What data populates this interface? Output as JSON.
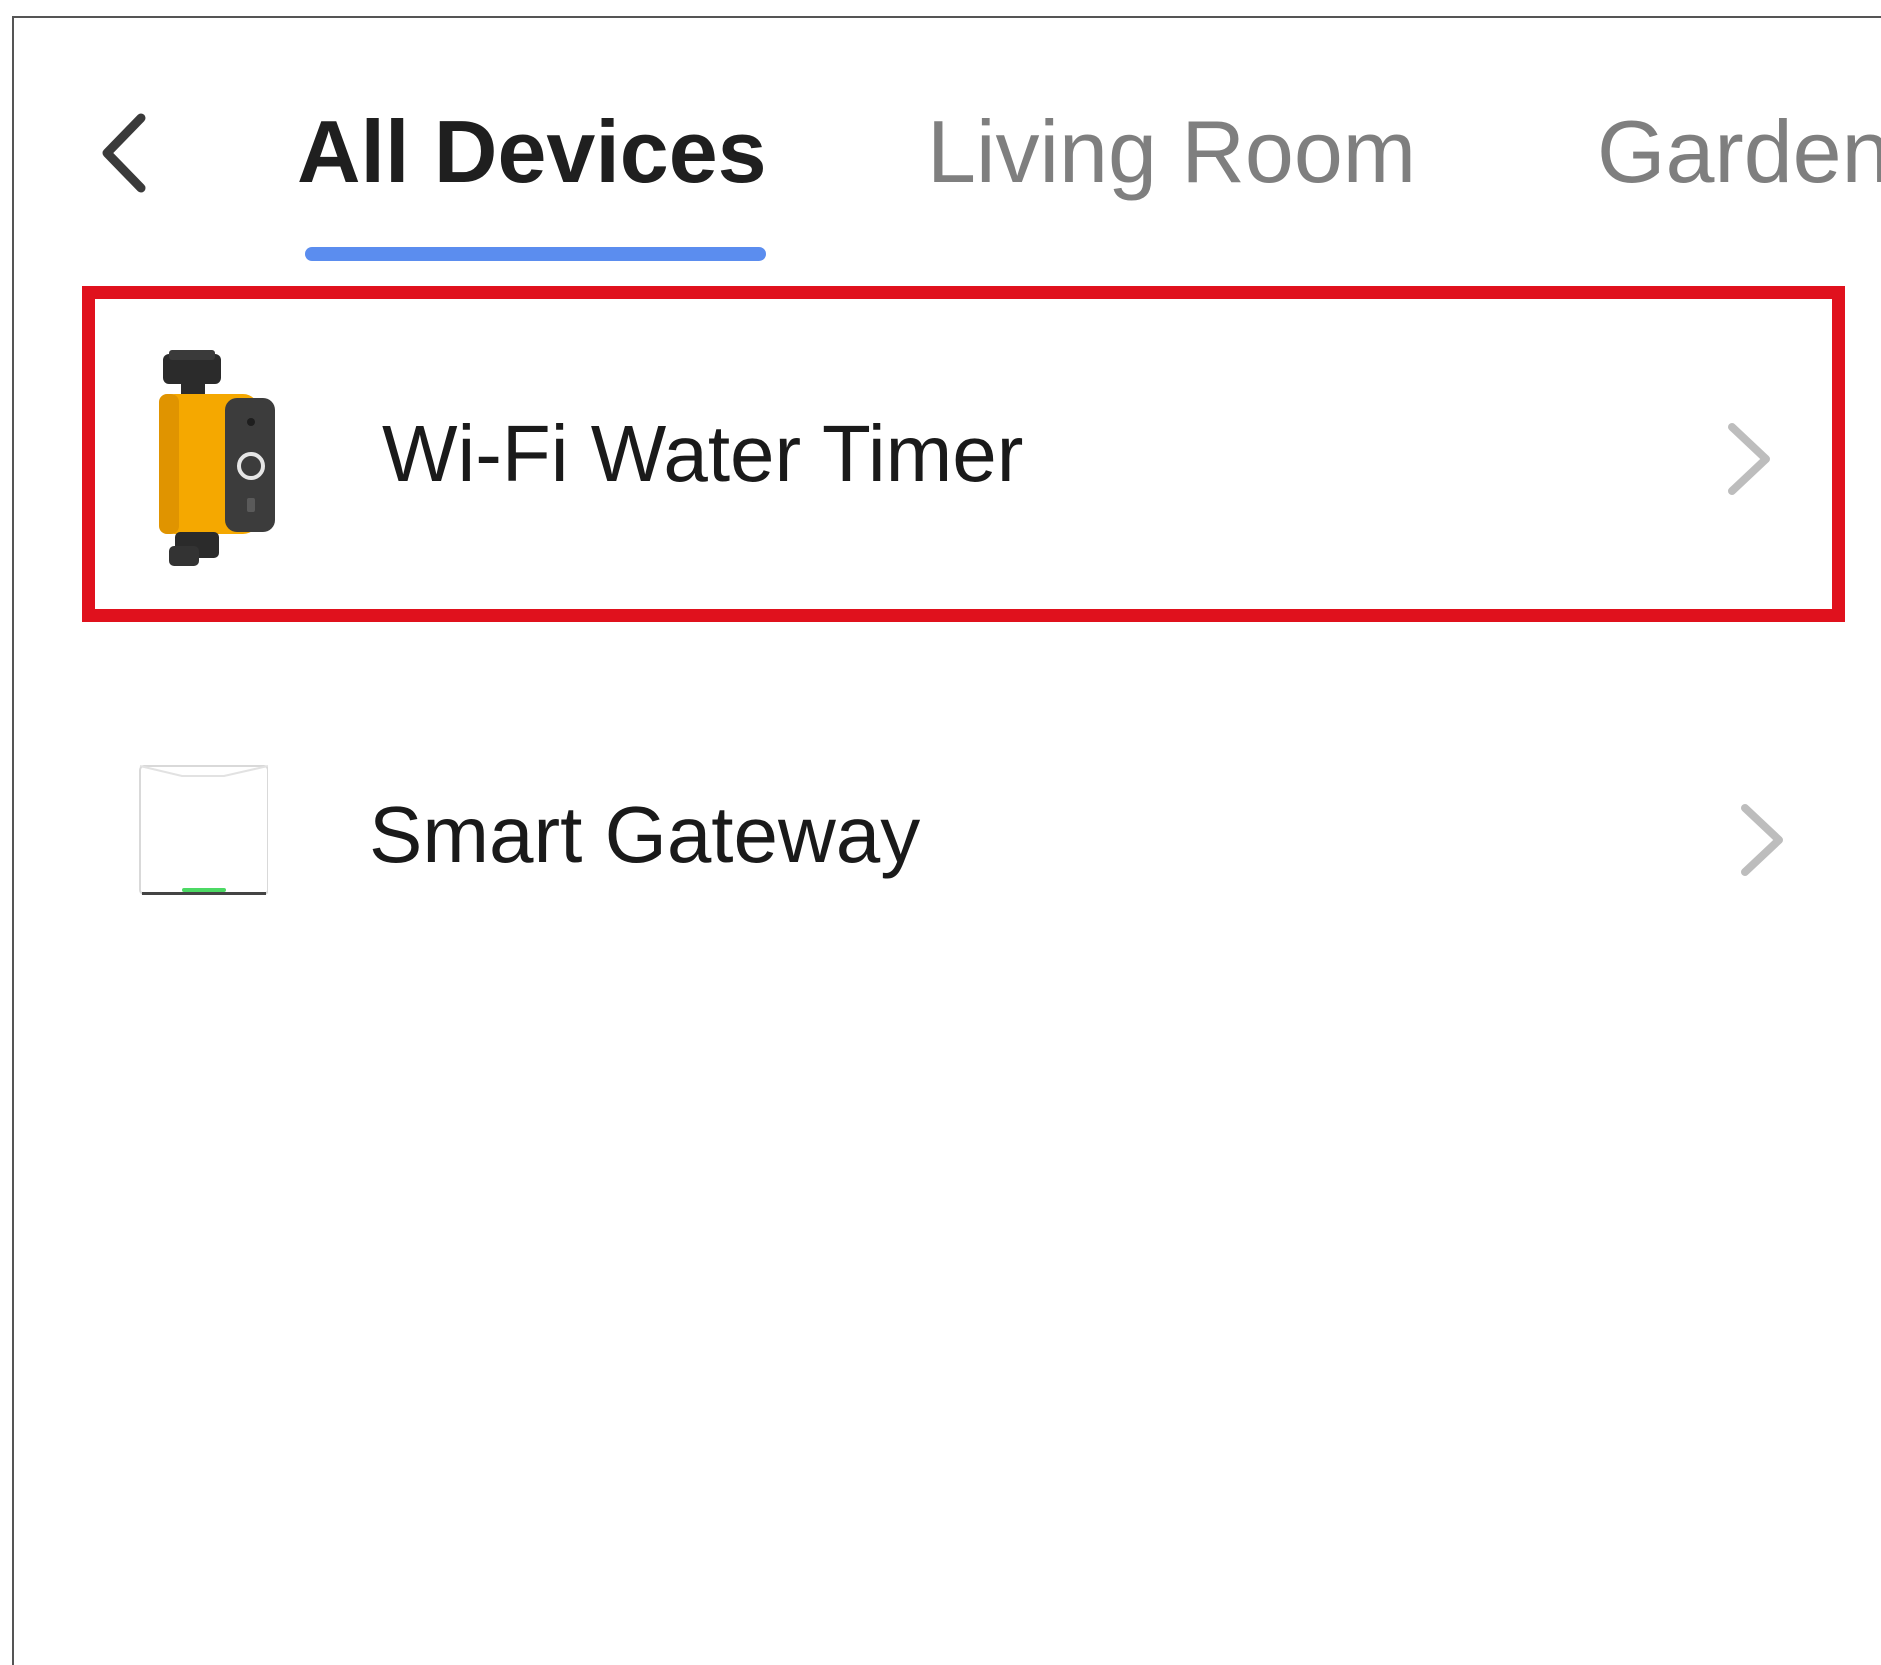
{
  "header": {
    "back_icon": "chevron-left-icon",
    "tabs": [
      {
        "label": "All Devices",
        "active": true
      },
      {
        "label": "Living Room",
        "active": false
      },
      {
        "label": "Garden",
        "active": false
      }
    ]
  },
  "devices": [
    {
      "name": "Wi-Fi Water Timer",
      "icon": "water-timer-device-icon",
      "chevron_icon": "chevron-right-icon",
      "highlighted": true
    },
    {
      "name": "Smart Gateway",
      "icon": "gateway-device-icon",
      "chevron_icon": "chevron-right-icon",
      "highlighted": false
    }
  ],
  "colors": {
    "accent": "#5b8def",
    "highlight_border": "#e0111d",
    "active_tab_text": "#1f1f1f",
    "inactive_tab_text": "#7f7f7f",
    "chevron": "#bdbdbd",
    "device_body_orange": "#f5a800",
    "device_body_dark": "#3c3c3c"
  }
}
